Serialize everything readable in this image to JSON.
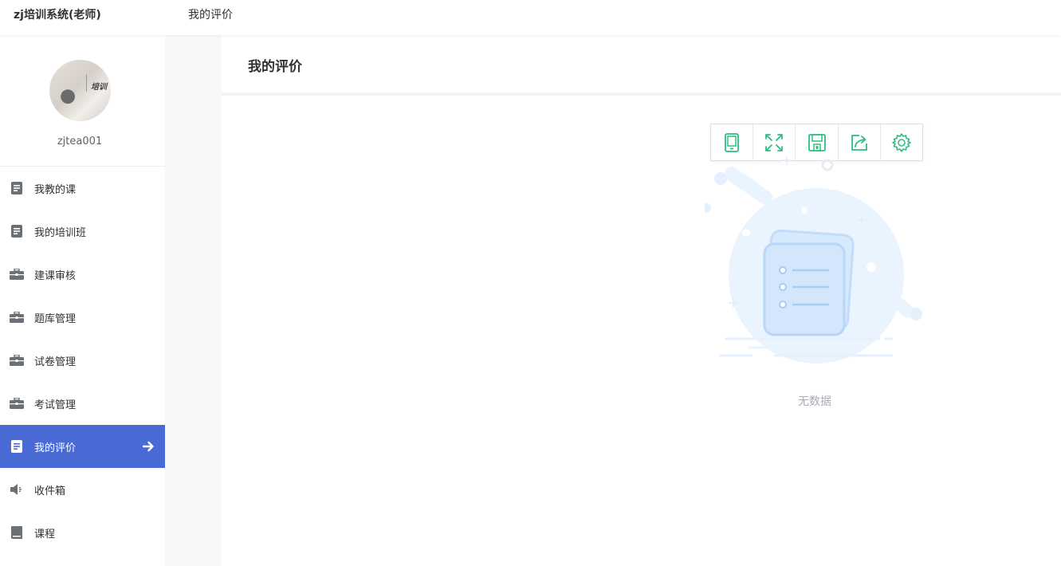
{
  "header": {
    "app_title": "zj培训系统(老师)",
    "breadcrumb": "我的评价"
  },
  "profile": {
    "username": "zjtea001",
    "avatar_text": "培训"
  },
  "sidebar": {
    "items": [
      {
        "label": "我教的课",
        "icon": "document-icon",
        "active": false
      },
      {
        "label": "我的培训班",
        "icon": "document-icon",
        "active": false
      },
      {
        "label": "建课审核",
        "icon": "briefcase-icon",
        "active": false
      },
      {
        "label": "题库管理",
        "icon": "briefcase-icon",
        "active": false
      },
      {
        "label": "试卷管理",
        "icon": "briefcase-icon",
        "active": false
      },
      {
        "label": "考试管理",
        "icon": "briefcase-icon",
        "active": false
      },
      {
        "label": "我的评价",
        "icon": "document-icon",
        "active": true
      },
      {
        "label": "收件箱",
        "icon": "speaker-icon",
        "active": false
      },
      {
        "label": "课程",
        "icon": "bookmark-icon",
        "active": false
      }
    ],
    "active_color": "#4a6bd6"
  },
  "main": {
    "title": "我的评价",
    "empty_text": "无数据"
  },
  "toolbox": {
    "icons": [
      "tablet-icon",
      "fullscreen-icon",
      "save-icon",
      "share-icon",
      "settings-icon"
    ],
    "accent": "#2dbf7f"
  }
}
